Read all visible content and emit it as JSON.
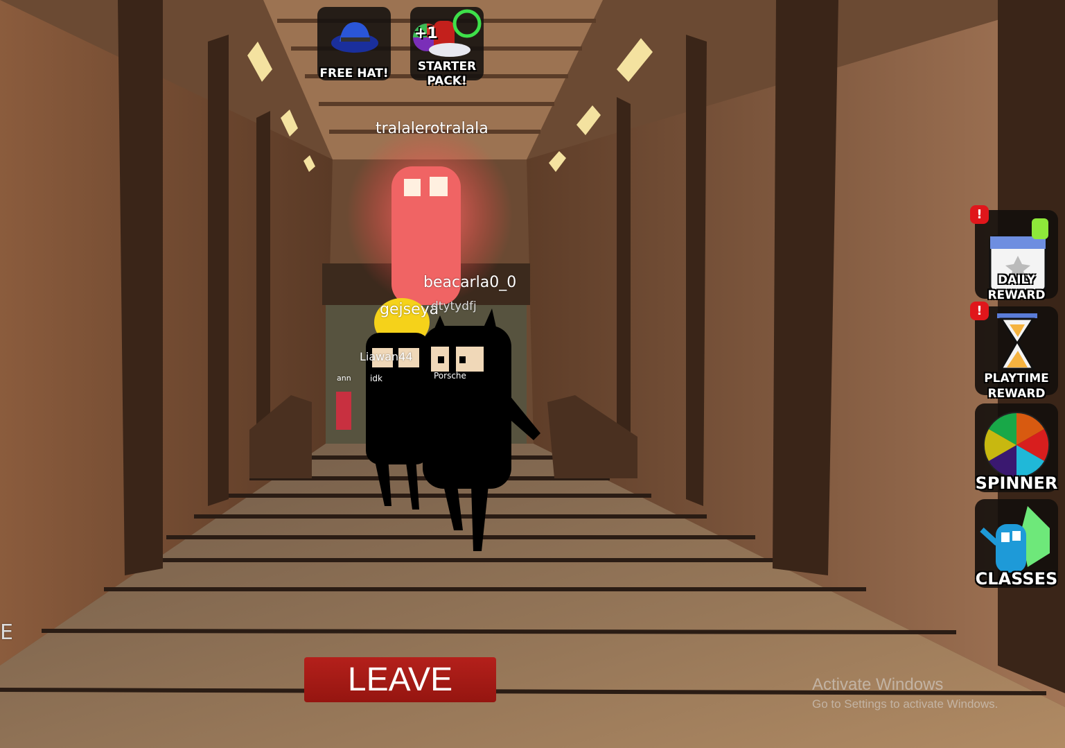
{
  "top_buttons": [
    {
      "label": "FREE HAT!",
      "icon": "blue-fedora-hat-icon"
    },
    {
      "label": "STARTER PACK!",
      "label_line1": "STARTER",
      "label_line2": "PACK!",
      "icon": "starter-pack-icon",
      "badge_text": "+1"
    }
  ],
  "side_buttons": [
    {
      "label_line1": "DAILY",
      "label_line2": "REWARD",
      "icon": "calendar-icon",
      "notification": "!"
    },
    {
      "label_line1": "PLAYTIME",
      "label_line2": "REWARD",
      "icon": "hourglass-icon",
      "notification": "!"
    },
    {
      "label": "SPINNER",
      "icon": "color-wheel-icon"
    },
    {
      "label": "CLASSES",
      "icon": "blue-character-icon"
    }
  ],
  "player_names": [
    "tralalerotralala",
    "beacarla0_0",
    "gejseya",
    "dtytydfj",
    "Liawan44",
    "ann",
    "idk",
    "Porsche"
  ],
  "edge_text": "E",
  "leave_button": "LEAVE",
  "watermark": {
    "title": "Activate Windows",
    "subtitle": "Go to Settings to activate Windows."
  },
  "colors": {
    "leave": "#a81a15",
    "badge": "#e0161b",
    "wall": "#8a5e40"
  }
}
